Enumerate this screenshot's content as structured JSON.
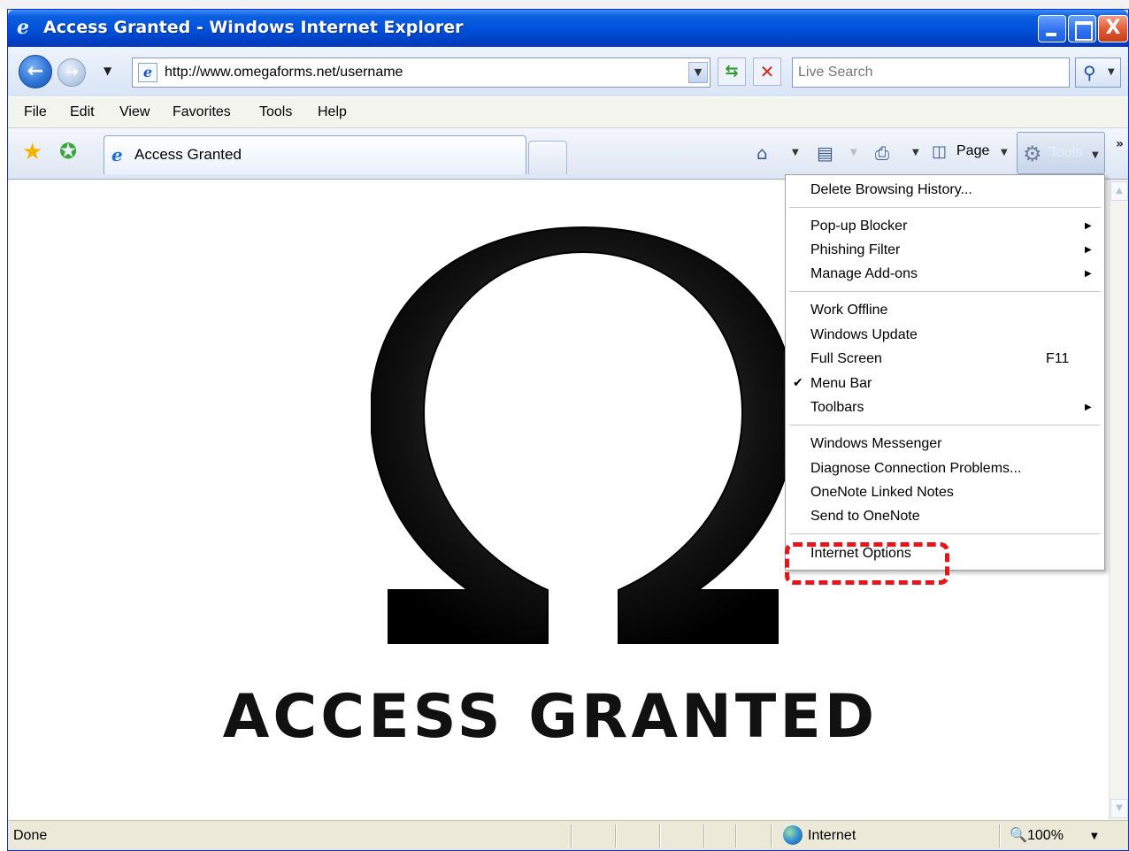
{
  "window": {
    "title": "Access Granted - Windows Internet Explorer",
    "close_glyph": "X"
  },
  "address": {
    "url": "http://www.omegaforms.net/username",
    "search_placeholder": "Live Search"
  },
  "menubar": {
    "items": [
      "File",
      "Edit",
      "View",
      "Favorites",
      "Tools",
      "Help"
    ]
  },
  "tabs": {
    "active_label": "Access Granted"
  },
  "commandbar": {
    "page_label": "Page",
    "tools_label": "Tools"
  },
  "content": {
    "logo_symbol": "Ω",
    "logo_text": "ACCESS GRANTED"
  },
  "tools_menu": {
    "items": [
      {
        "label": "Delete Browsing History...",
        "submenu": false
      },
      {
        "label": "Pop-up Blocker",
        "submenu": true
      },
      {
        "label": "Phishing Filter",
        "submenu": true
      },
      {
        "label": "Manage Add-ons",
        "submenu": true
      },
      {
        "label": "Work Offline",
        "submenu": false
      },
      {
        "label": "Windows Update",
        "submenu": false
      },
      {
        "label": "Full Screen",
        "shortcut": "F11"
      },
      {
        "label": "Menu Bar",
        "checked": true
      },
      {
        "label": "Toolbars",
        "submenu": true
      },
      {
        "label": "Windows Messenger",
        "submenu": false
      },
      {
        "label": "Diagnose Connection Problems...",
        "submenu": false
      },
      {
        "label": "OneNote Linked Notes",
        "submenu": false
      },
      {
        "label": "Send to OneNote",
        "submenu": false
      },
      {
        "label": "Internet Options",
        "submenu": false,
        "highlighted": true
      }
    ],
    "highlight_color": "#e8141c"
  },
  "statusbar": {
    "status": "Done",
    "zone": "Internet",
    "zoom": "100%"
  },
  "icons": {
    "back": "back-arrow-icon",
    "forward": "forward-arrow-icon",
    "refresh": "refresh-icon",
    "stop": "stop-icon",
    "search": "magnifier-icon",
    "favorites": "star-icon",
    "add_favorites": "add-favorite-icon",
    "home": "home-icon",
    "feeds": "rss-icon",
    "print": "printer-icon",
    "tools": "gear-icon",
    "zone": "globe-icon"
  }
}
